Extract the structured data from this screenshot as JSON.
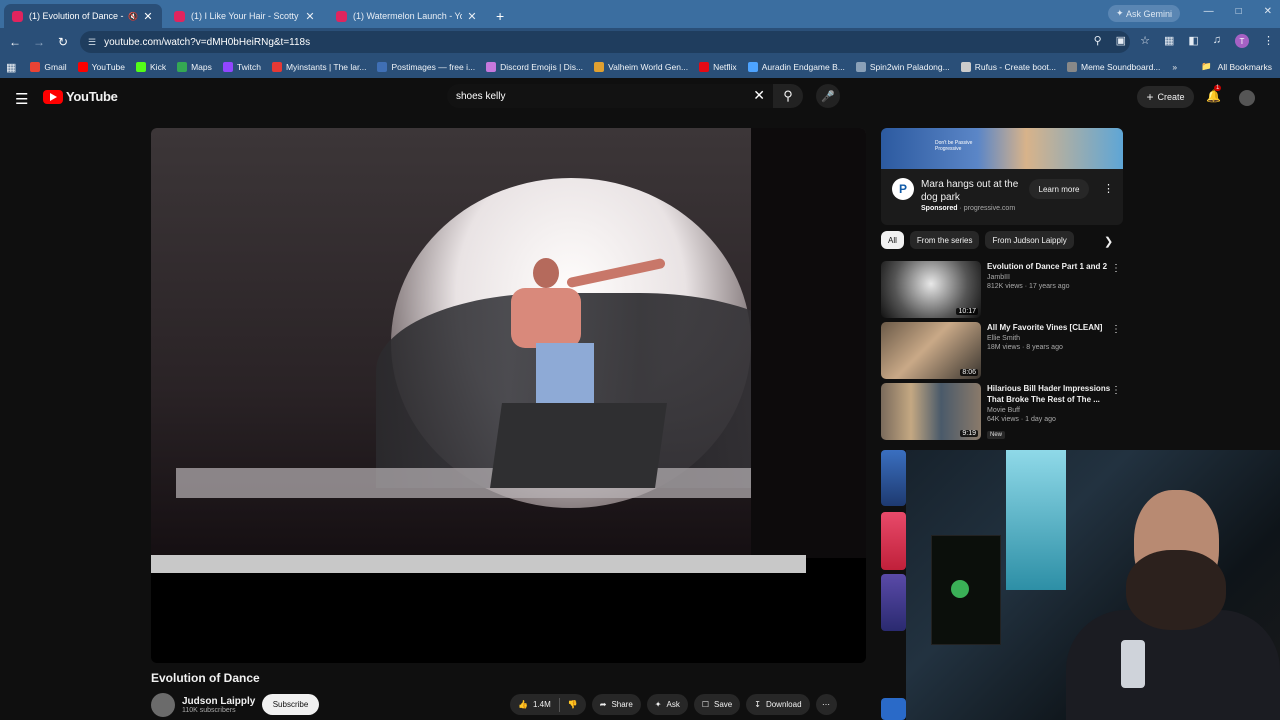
{
  "browser": {
    "tabs": [
      {
        "title": "(1) Evolution of Dance - You",
        "active": true,
        "muted": true
      },
      {
        "title": "(1) I Like Your Hair - Scotty Van",
        "active": false
      },
      {
        "title": "(1) Watermelon Launch - YouTu",
        "active": false
      }
    ],
    "new_tab": "+",
    "gemini": "Ask Gemini",
    "url": "youtube.com/watch?v=dMH0bHeiRNg&t=118s",
    "profile_initial": "T",
    "bookmarks": [
      {
        "label": "Gmail",
        "color": "#ea4335"
      },
      {
        "label": "YouTube",
        "color": "#ff0000"
      },
      {
        "label": "Kick",
        "color": "#53fc18"
      },
      {
        "label": "Maps",
        "color": "#34a853"
      },
      {
        "label": "Twitch",
        "color": "#9146ff"
      },
      {
        "label": "Myinstants | The lar...",
        "color": "#e53935"
      },
      {
        "label": "Postimages — free i...",
        "color": "#3f6fb5"
      },
      {
        "label": "Discord Emojis | Dis...",
        "color": "#c678dd"
      },
      {
        "label": "Valheim World Gen...",
        "color": "#e0a030"
      },
      {
        "label": "Netflix",
        "color": "#e50914"
      },
      {
        "label": "Auradin Endgame B...",
        "color": "#4da3ff"
      },
      {
        "label": "Spin2win Paladong...",
        "color": "#8aa0b8"
      },
      {
        "label": "Rufus - Create boot...",
        "color": "#cccccc"
      },
      {
        "label": "Meme Soundboard...",
        "color": "#888888"
      }
    ],
    "all_bookmarks": "All Bookmarks"
  },
  "youtube": {
    "logo": "YouTube",
    "search_value": "shoes kelly",
    "create": "Create",
    "notification_count": "1"
  },
  "video": {
    "title": "Evolution of Dance",
    "channel": "Judson Laipply",
    "subscribers": "110K subscribers",
    "subscribe": "Subscribe",
    "likes": "1.4M",
    "share": "Share",
    "ask": "Ask",
    "save": "Save",
    "download": "Download"
  },
  "ad": {
    "banner_text": "Don't be Passive Progressive",
    "title": "Mara hangs out at the dog park",
    "sponsored": "Sponsored",
    "domain": "progressive.com",
    "cta": "Learn more"
  },
  "chips": [
    "All",
    "From the series",
    "From Judson Laipply"
  ],
  "recommendations": [
    {
      "title": "Evolution of Dance Part 1 and 2",
      "channel": "JambIII",
      "meta": "812K views · 17 years ago",
      "duration": "10:17"
    },
    {
      "title": "All My Favorite Vines [CLEAN]",
      "channel": "Ellie Smith",
      "meta": "18M views · 8 years ago",
      "duration": "8:06"
    },
    {
      "title": "Hilarious Bill Hader Impressions That Broke The Rest of The ...",
      "channel": "Movie Buff",
      "meta": "64K views · 1 day ago",
      "duration": "9:19",
      "badge": "New"
    }
  ]
}
